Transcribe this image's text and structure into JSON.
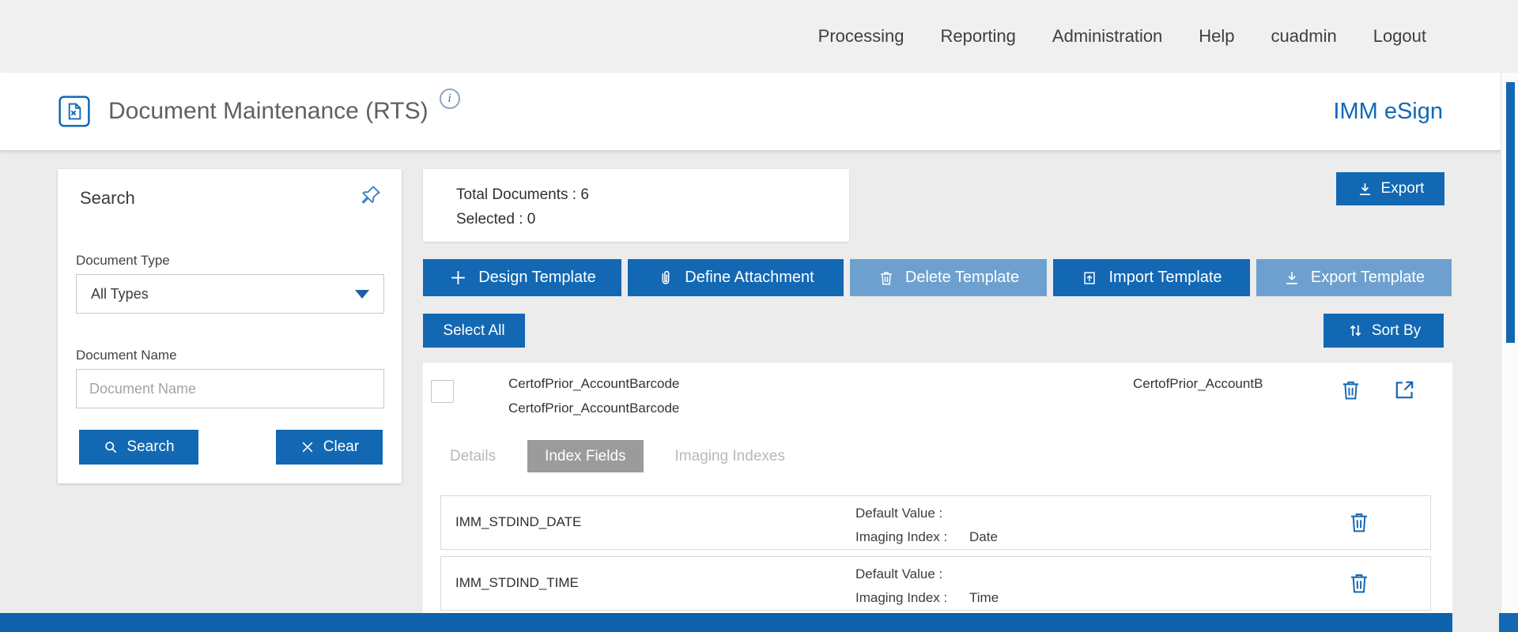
{
  "colors": {
    "accent": "#1268b3",
    "accent_light": "#6da0ce",
    "tab_active_bg": "#9b9b9b",
    "bottom_bar": "#0f62ac"
  },
  "topnav": {
    "items": [
      "Processing",
      "Reporting",
      "Administration",
      "Help",
      "cuadmin",
      "Logout"
    ]
  },
  "header": {
    "title": "Document Maintenance (RTS)",
    "info_icon": "i",
    "brand": "IMM eSign"
  },
  "search_panel": {
    "title": "Search",
    "document_type": {
      "label": "Document Type",
      "value": "All Types"
    },
    "document_name": {
      "label": "Document Name",
      "placeholder": "Document Name"
    },
    "search_button": "Search",
    "clear_button": "Clear"
  },
  "summary": {
    "total": "Total Documents : 6",
    "selected": "Selected : 0"
  },
  "toolbar": {
    "export_button": "Export",
    "buttons": [
      {
        "label": "Design Template",
        "icon": "plus-icon",
        "state": "enabled"
      },
      {
        "label": "Define Attachment",
        "icon": "paperclip-icon",
        "state": "enabled"
      },
      {
        "label": "Delete Template",
        "icon": "trash-icon",
        "state": "disabled"
      },
      {
        "label": "Import Template",
        "icon": "import-icon",
        "state": "enabled"
      },
      {
        "label": "Export Template",
        "icon": "download-icon",
        "state": "disabled"
      }
    ],
    "select_all_button": "Select All",
    "sort_by_button": "Sort By"
  },
  "document": {
    "name_line1": "CertofPrior_AccountBarcode",
    "name_line2": "CertofPrior_AccountBarcode",
    "name_right": "CertofPrior_AccountB",
    "selected": false
  },
  "tabs": [
    {
      "label": "Details",
      "active": false
    },
    {
      "label": "Index Fields",
      "active": true
    },
    {
      "label": "Imaging Indexes",
      "active": false
    }
  ],
  "index_fields": [
    {
      "name": "IMM_STDIND_DATE",
      "default_value_label": "Default Value :",
      "default_value": "",
      "imaging_index_label": "Imaging Index :",
      "imaging_index": "Date"
    },
    {
      "name": "IMM_STDIND_TIME",
      "default_value_label": "Default Value :",
      "default_value": "",
      "imaging_index_label": "Imaging Index :",
      "imaging_index": "Time"
    }
  ]
}
